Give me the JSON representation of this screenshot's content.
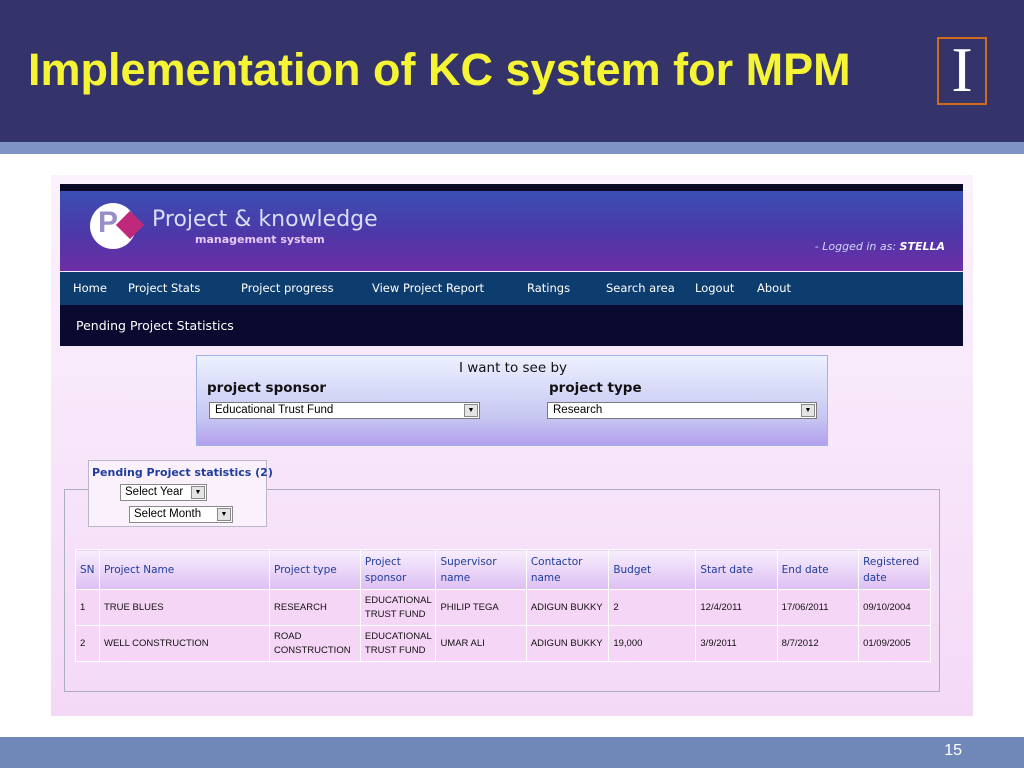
{
  "slide": {
    "title": "Implementation of KC system for MPM",
    "page_number": "15",
    "colors": {
      "title_bar": "#35346a",
      "title_text": "#f5f536",
      "stripe": "#7f94c2",
      "footer": "#7088b8"
    }
  },
  "app": {
    "name": "Project & knowledge",
    "subtitle": "management system",
    "login_prefix": "- Logged in as: ",
    "user": "STELLA",
    "nav": [
      "Home",
      "Project Stats",
      "Project progress",
      "View Project Report",
      "Ratings",
      "Search area",
      "Logout",
      "About"
    ],
    "page_title": "Pending Project Statistics"
  },
  "filter": {
    "heading": "I want to see by",
    "sponsor_label": "project sponsor",
    "sponsor_value": "Educational Trust Fund",
    "type_label": "project type",
    "type_value": "Research"
  },
  "stats": {
    "legend": "Pending Project statistics (2)",
    "year_select": "Select Year",
    "month_select": "Select Month",
    "columns": [
      "SN",
      "Project Name",
      "Project type",
      "Project sponsor",
      "Supervisor name",
      "Contactor name",
      "Budget",
      "Start date",
      "End date",
      "Registered date"
    ],
    "rows": [
      [
        "1",
        "TRUE BLUES",
        "RESEARCH",
        "EDUCATIONAL TRUST FUND",
        "PHILIP TEGA",
        "ADIGUN BUKKY",
        "2",
        "12/4/2011",
        "17/06/2011",
        "09/10/2004"
      ],
      [
        "2",
        "WELL CONSTRUCTION",
        "ROAD CONSTRUCTION",
        "EDUCATIONAL TRUST FUND",
        "UMAR ALI",
        "ADIGUN BUKKY",
        "19,000",
        "3/9/2011",
        "8/7/2012",
        "01/09/2005"
      ]
    ]
  }
}
